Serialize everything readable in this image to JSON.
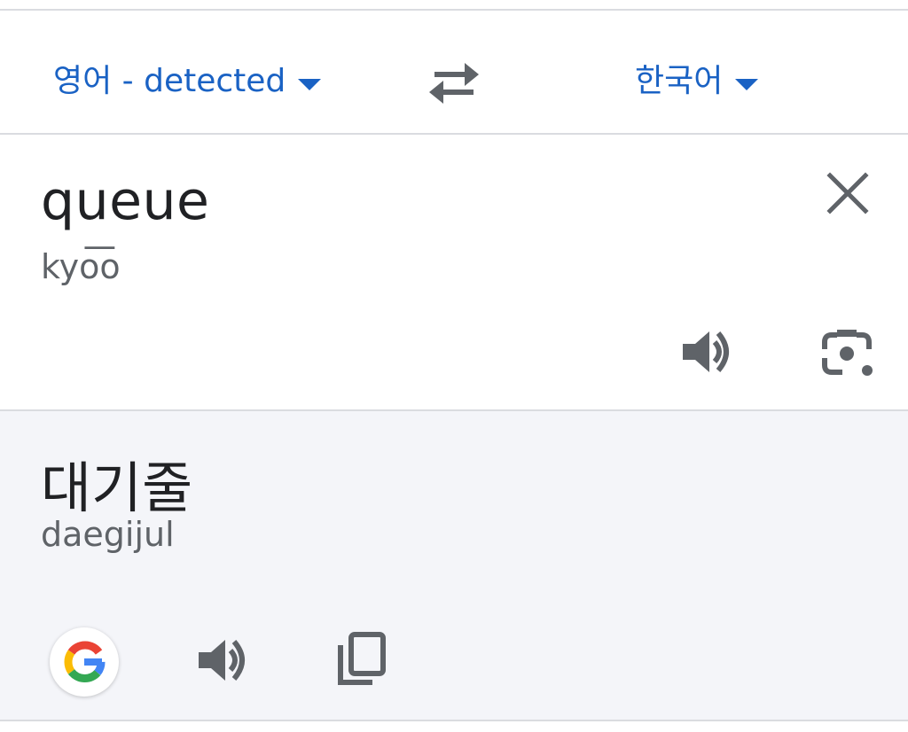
{
  "language_bar": {
    "source_language": "영어 - detected",
    "target_language": "한국어"
  },
  "source": {
    "text": "queue",
    "transliteration": "kyo͞o"
  },
  "target": {
    "text": "대기줄",
    "transliteration": "daegijul"
  },
  "icons": {
    "swap": "swap-arrows-icon",
    "clear": "close-icon",
    "source_speaker": "speaker-icon",
    "lens": "camera-lens-icon",
    "google": "google-logo-icon",
    "target_speaker": "speaker-icon",
    "copy": "copy-icon"
  },
  "colors": {
    "accent": "#1a62c4",
    "icon": "#5f6368",
    "target_background": "#f4f5f9",
    "divider": "#dadce0"
  }
}
